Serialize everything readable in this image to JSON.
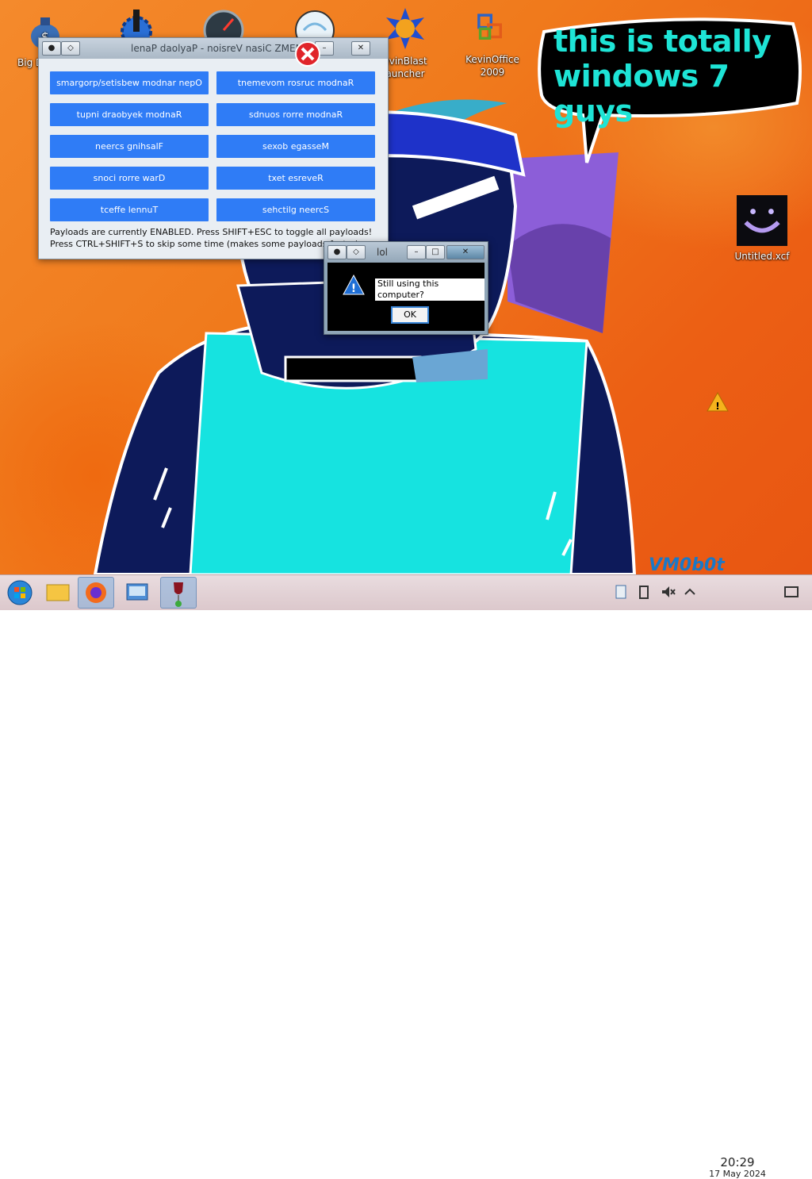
{
  "desktop": {
    "icons": [
      {
        "label": "Big\nDe",
        "icon": "money-bag-icon"
      },
      {
        "label": "",
        "icon": "gear-icon"
      },
      {
        "label": "",
        "icon": "speedometer-icon"
      },
      {
        "label": "",
        "icon": "globe-icon"
      },
      {
        "label": "evinBlast\nauncher",
        "icon": "kevinblast-icon"
      },
      {
        "label": "KevinOffice\n2009",
        "icon": "office-icon"
      },
      {
        "label": "Untitled.xcf",
        "icon": "xcf-image-icon"
      }
    ],
    "bubble_text": "this is totally windows 7 guys",
    "watermark": "VM0b0t"
  },
  "panel": {
    "title": "lenaP daolyaP - noisreV nasiC ZMEM",
    "buttons": [
      "smargorp/setisbew modnar nepO",
      "tnemevom rosruc modnaR",
      "tupni draobyek modnaR",
      "sdnuos rorre modnaR",
      "neercs gnihsalF",
      "sexob egasseM",
      "snoci rorre warD",
      "txet esreveR",
      "tceffe lennuT",
      "sehctilg neercS"
    ],
    "info_line1": "Payloads are currently ENABLED. Press SHIFT+ESC to toggle all payloads!",
    "info_line2": "Press CTRL+SHIFT+S to skip some time (makes some payloads faster)"
  },
  "dialog": {
    "title": "lol",
    "message": "Still using this computer?",
    "ok_label": "OK",
    "icon": "warning-icon"
  },
  "taskbar": {
    "items": [
      "start-orb-icon",
      "file-explorer-icon",
      "firefox-icon",
      "control-panel-icon",
      "wine-icon"
    ],
    "clock_time": "20:29",
    "clock_date": "17 May 2024"
  }
}
